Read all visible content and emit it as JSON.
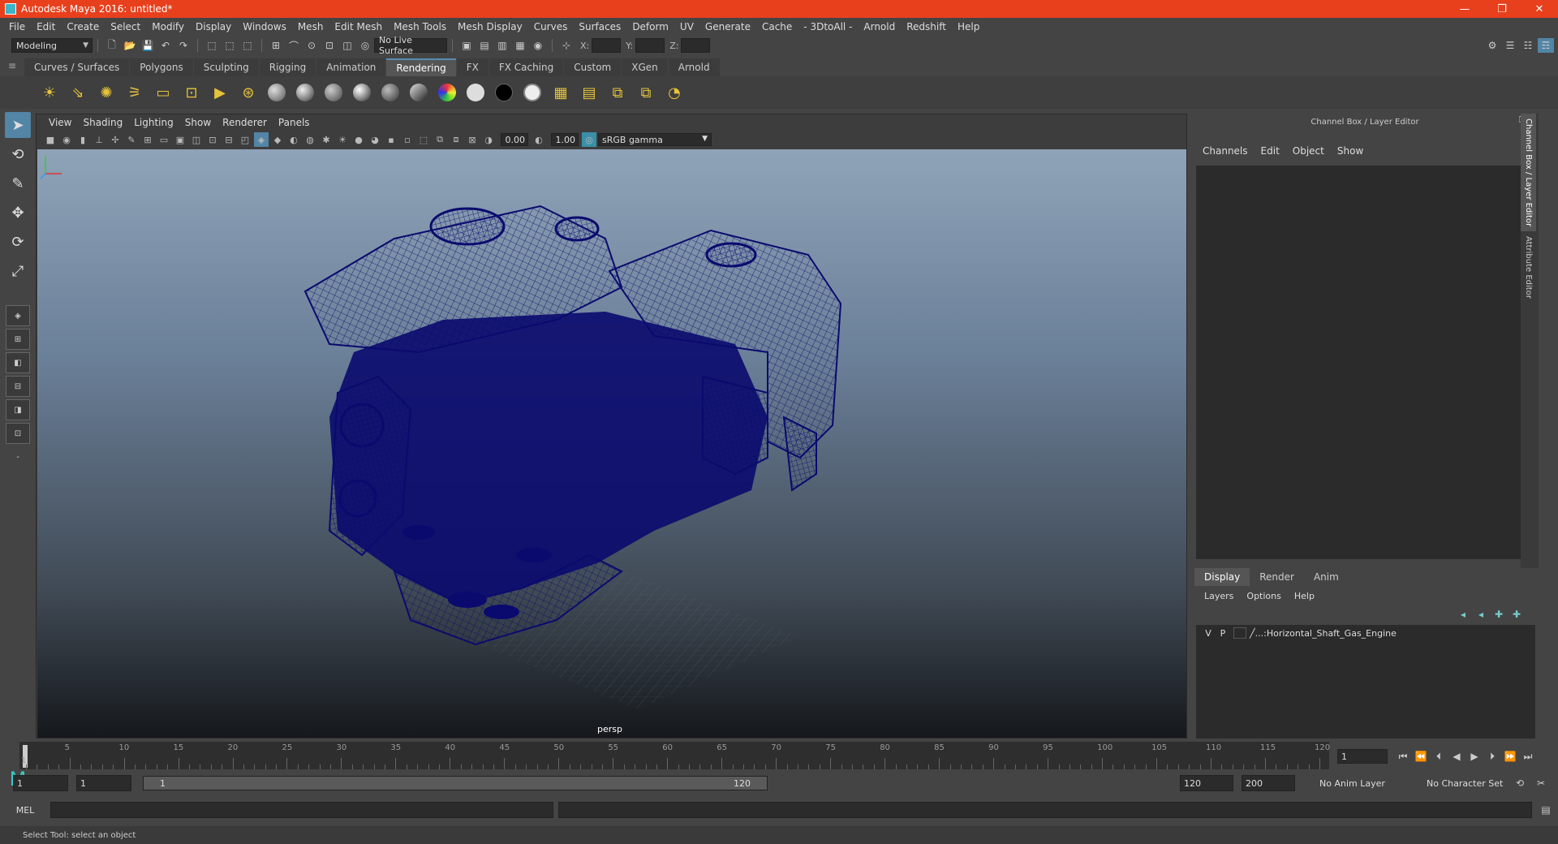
{
  "window": {
    "title": "Autodesk Maya 2016: untitled*",
    "minimize": "—",
    "restore": "❐",
    "close": "✕"
  },
  "menubar": [
    "File",
    "Edit",
    "Create",
    "Select",
    "Modify",
    "Display",
    "Windows",
    "Mesh",
    "Edit Mesh",
    "Mesh Tools",
    "Mesh Display",
    "Curves",
    "Surfaces",
    "Deform",
    "UV",
    "Generate",
    "Cache",
    "- 3DtoAll -",
    "Arnold",
    "Redshift",
    "Help"
  ],
  "statusline": {
    "mode": "Modeling",
    "live_surface": "No Live Surface",
    "x_label": "X:",
    "y_label": "Y:",
    "z_label": "Z:"
  },
  "shelf_tabs": [
    "Curves / Surfaces",
    "Polygons",
    "Sculpting",
    "Rigging",
    "Animation",
    "Rendering",
    "FX",
    "FX Caching",
    "Custom",
    "XGen",
    "Arnold"
  ],
  "shelf_active": "Rendering",
  "viewport": {
    "menu": [
      "View",
      "Shading",
      "Lighting",
      "Show",
      "Renderer",
      "Panels"
    ],
    "exposure": "0.00",
    "gamma_value": "1.00",
    "color_space": "sRGB gamma",
    "camera": "persp"
  },
  "channelbox": {
    "title": "Channel Box / Layer Editor",
    "menu": [
      "Channels",
      "Edit",
      "Object",
      "Show"
    ],
    "layer_tabs": [
      "Display",
      "Render",
      "Anim"
    ],
    "layer_active": "Display",
    "layer_menu": [
      "Layers",
      "Options",
      "Help"
    ],
    "layer": {
      "v": "V",
      "p": "P",
      "name": "...:Horizontal_Shaft_Gas_Engine"
    },
    "side_tabs": [
      "Channel Box / Layer Editor",
      "Attribute Editor"
    ]
  },
  "timeline": {
    "ticks": [
      5,
      10,
      15,
      20,
      25,
      30,
      35,
      40,
      45,
      50,
      55,
      60,
      65,
      70,
      75,
      80,
      85,
      90,
      95,
      100,
      105,
      110,
      115,
      120
    ],
    "start_label": "1",
    "current_frame": "1"
  },
  "range": {
    "start": "1",
    "anim_start": "1",
    "slider_start": "1",
    "slider_end": "120",
    "anim_end": "120",
    "end": "200",
    "anim_layer": "No Anim Layer",
    "char_set": "No Character Set"
  },
  "cmdline": {
    "label": "MEL"
  },
  "helpline": {
    "text": "Select Tool: select an object"
  },
  "colors": {
    "titlebar": "#e8401c",
    "wireframe": "#0a0a6e",
    "accent": "#5285a6"
  }
}
